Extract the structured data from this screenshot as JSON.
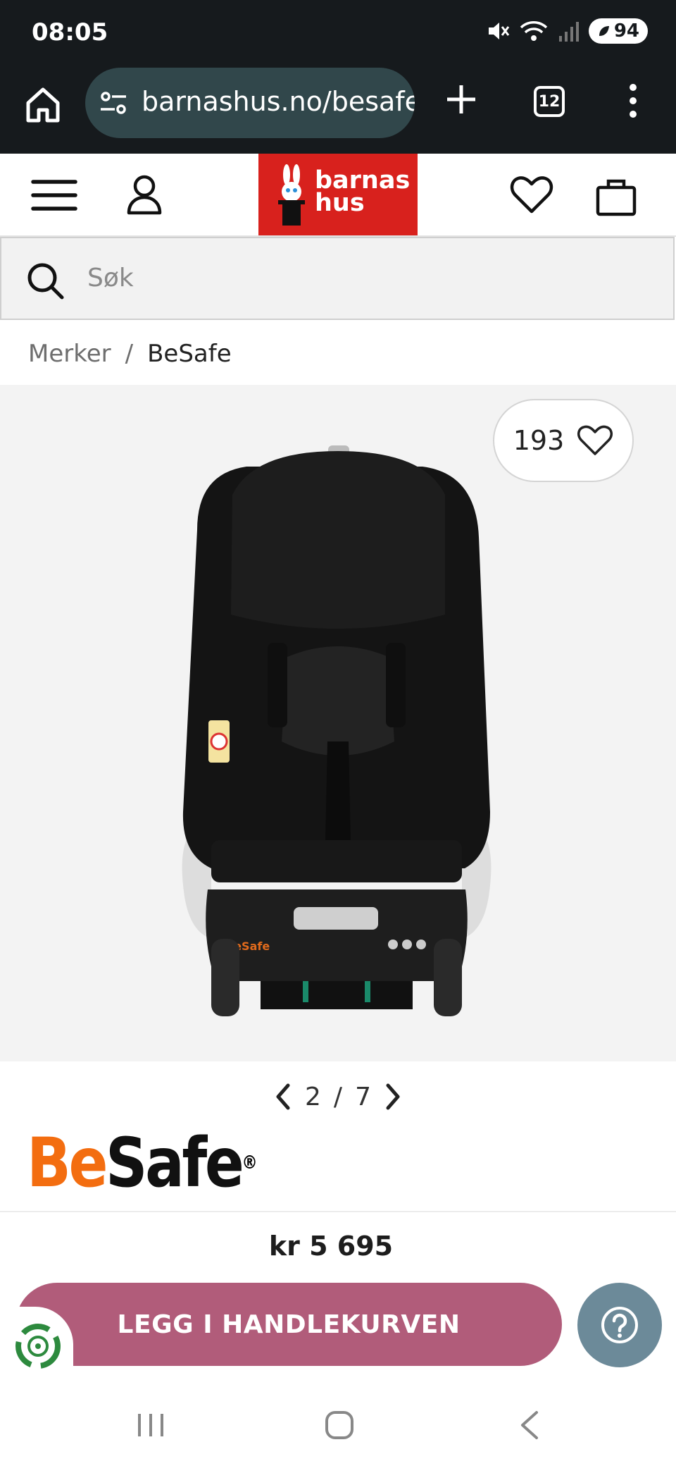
{
  "status": {
    "time": "08:05",
    "battery": "94"
  },
  "browser": {
    "url": "barnashus.no/besafe",
    "tab_count": "12"
  },
  "site": {
    "logo_line1": "barnas",
    "logo_line2": "hus"
  },
  "search": {
    "placeholder": "Søk"
  },
  "breadcrumb": {
    "items": [
      "Merker",
      "BeSafe"
    ],
    "separator": "/"
  },
  "product": {
    "favorite_count": "193",
    "image_index": "2",
    "image_total": "7",
    "brand": {
      "be": "Be",
      "safe": "Safe",
      "mark": "®"
    },
    "price": "kr 5 695",
    "cta_label": "LEGG I HANDLEKURVEN"
  },
  "colors": {
    "logo_red": "#d8211d",
    "cta": "#b15c7a",
    "help": "#6c8a99",
    "brand_orange": "#f36d10"
  }
}
